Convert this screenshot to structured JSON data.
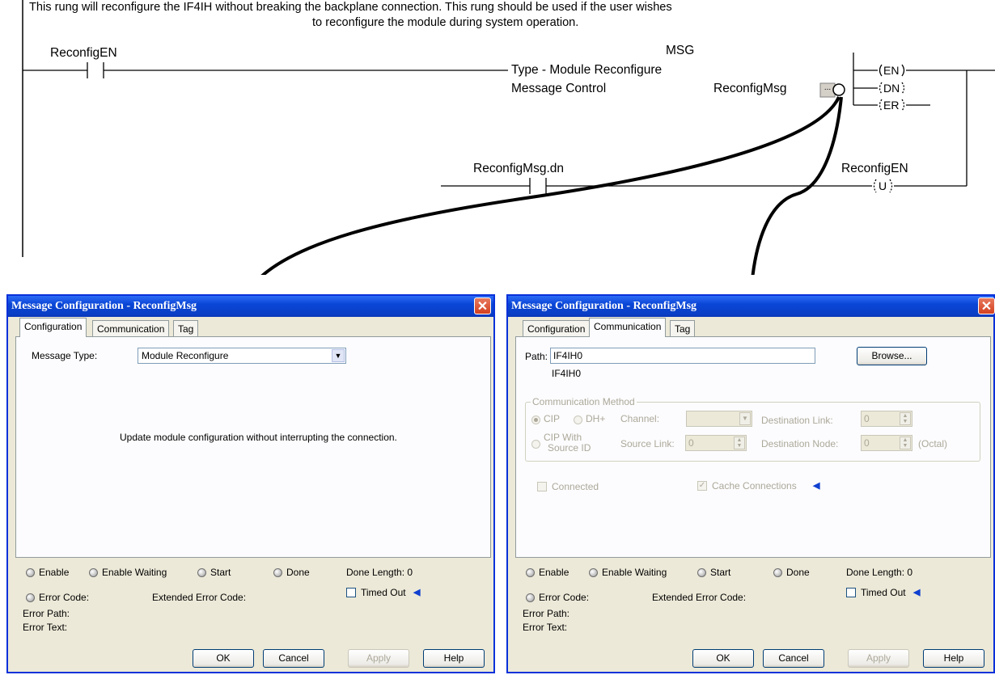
{
  "rung": {
    "comment_line1": "This rung will reconfigure the IF4IH without breaking the backplane connection.  This rung should be used if the user wishes",
    "comment_line2": "to reconfigure the module during system operation.",
    "contact1_tag": "ReconfigEN",
    "msg_title": "MSG",
    "msg_type": "Type - Module Reconfigure",
    "msg_control_label": "Message Control",
    "msg_control_tag": "ReconfigMsg",
    "msg_control_ellipsis": "...",
    "coil_en": "EN",
    "coil_dn": "DN",
    "coil_er": "ER",
    "contact2_tag": "ReconfigMsg.dn",
    "unlatch_tag": "ReconfigEN",
    "unlatch_letter": "U"
  },
  "dialog_left": {
    "title": "Message Configuration - ReconfigMsg",
    "tabs": [
      "Configuration",
      "Communication",
      "Tag"
    ],
    "active_tab": "Configuration",
    "message_type_label": "Message Type:",
    "message_type_value": "Module Reconfigure",
    "description": "Update module configuration without interrupting the connection.",
    "status": {
      "enable": "Enable",
      "enable_waiting": "Enable Waiting",
      "start": "Start",
      "done": "Done",
      "done_length": "Done Length: 0",
      "error_code": "Error Code:",
      "extended_error_code": "Extended Error Code:",
      "timed_out": "Timed Out",
      "error_path": "Error Path:",
      "error_text": "Error Text:"
    },
    "buttons": {
      "ok": "OK",
      "cancel": "Cancel",
      "apply": "Apply",
      "help": "Help"
    }
  },
  "dialog_right": {
    "title": "Message Configuration - ReconfigMsg",
    "tabs": [
      "Configuration",
      "Communication",
      "Tag"
    ],
    "active_tab": "Communication",
    "path_label": "Path:",
    "path_value": "IF4IH0",
    "path_resolved": "IF4IH0",
    "browse_label": "Browse...",
    "comm_method_group": "Communication Method",
    "cip_label": "CIP",
    "dh_label": "DH+",
    "channel_label": "Channel:",
    "dest_link_label": "Destination Link:",
    "dest_link_value": "0",
    "cip_source_label_1": "CIP With",
    "cip_source_label_2": "Source ID",
    "source_link_label": "Source Link:",
    "source_link_value": "0",
    "dest_node_label": "Destination Node:",
    "dest_node_value": "0",
    "octal_label": "(Octal)",
    "connected_label": "Connected",
    "cache_label": "Cache Connections",
    "status": {
      "enable": "Enable",
      "enable_waiting": "Enable Waiting",
      "start": "Start",
      "done": "Done",
      "done_length": "Done Length: 0",
      "error_code": "Error Code:",
      "extended_error_code": "Extended Error Code:",
      "timed_out": "Timed Out",
      "error_path": "Error Path:",
      "error_text": "Error Text:"
    },
    "buttons": {
      "ok": "OK",
      "cancel": "Cancel",
      "apply": "Apply",
      "help": "Help"
    }
  },
  "colors": {
    "titlebar": "#0a46d6",
    "dialog_bg": "#ece9d8",
    "close_button": "#d3401f",
    "disabled_text": "#aca899"
  }
}
